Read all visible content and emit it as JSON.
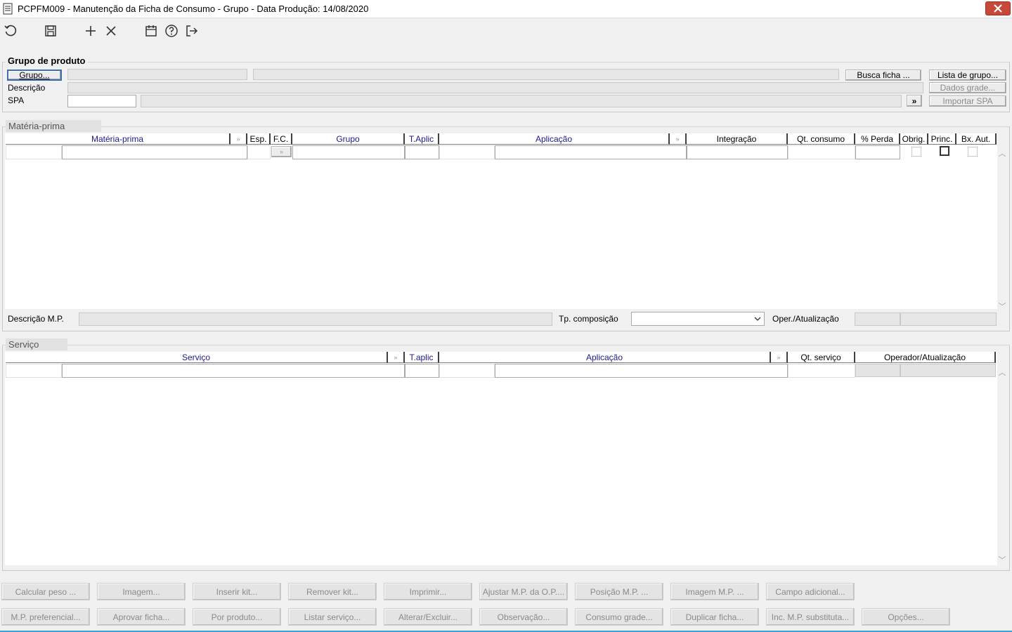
{
  "window": {
    "title": "PCPFM009 - Manutenção da Ficha de Consumo - Grupo - Data Produção: 14/08/2020"
  },
  "toolbar": {
    "icons": [
      "refresh-icon",
      "save-icon",
      "add-icon",
      "delete-icon",
      "calendar-icon",
      "help-icon",
      "exit-icon"
    ]
  },
  "grupo_produto": {
    "legend": "Grupo de produto",
    "grupo_button": "Grupo...",
    "descricao_label": "Descrição",
    "spa_label": "SPA",
    "busca_ficha": "Busca ficha ...",
    "lista_grupo": "Lista de grupo...",
    "dados_grade": "Dados grade...",
    "importar_spa": "Importar SPA",
    "spa_next": "»"
  },
  "materia_prima": {
    "legend": "Matéria-prima",
    "columns": [
      "Matéria-prima",
      "Esp.",
      "F.C.",
      "Grupo",
      "T.Aplic",
      "Aplicação",
      "Integração",
      "Qt. consumo",
      "% Perda",
      "Obrig.",
      "Princ.",
      "Bx. Aut."
    ],
    "descricao_mp_label": "Descrição M.P.",
    "tp_composicao_label": "Tp. composição",
    "oper_atualizacao_label": "Oper./Atualização"
  },
  "servico": {
    "legend": "Serviço",
    "columns": [
      "Serviço",
      "T.aplic",
      "Aplicação",
      "Qt. serviço",
      "Operador/Atualização"
    ]
  },
  "bottom_buttons": {
    "row1": [
      "Calcular peso ...",
      "Imagem...",
      "Inserir kit...",
      "Remover kit...",
      "Imprimir...",
      "Ajustar M.P. da O.P....",
      "Posição M.P. ...",
      "Imagem M.P. ...",
      "Campo adicional..."
    ],
    "row2": [
      "M.P. preferencial...",
      "Aprovar ficha...",
      "Por produto...",
      "Listar serviço...",
      "Alterar/Excluir...",
      "Observação...",
      "Consumo grade...",
      "Duplicar ficha...",
      "Inc. M.P. substituta...",
      "Opções..."
    ]
  },
  "colors": {
    "close": "#c7493a",
    "header_text": "#1a1a8c",
    "accent_strip": "#3aa4d4"
  }
}
